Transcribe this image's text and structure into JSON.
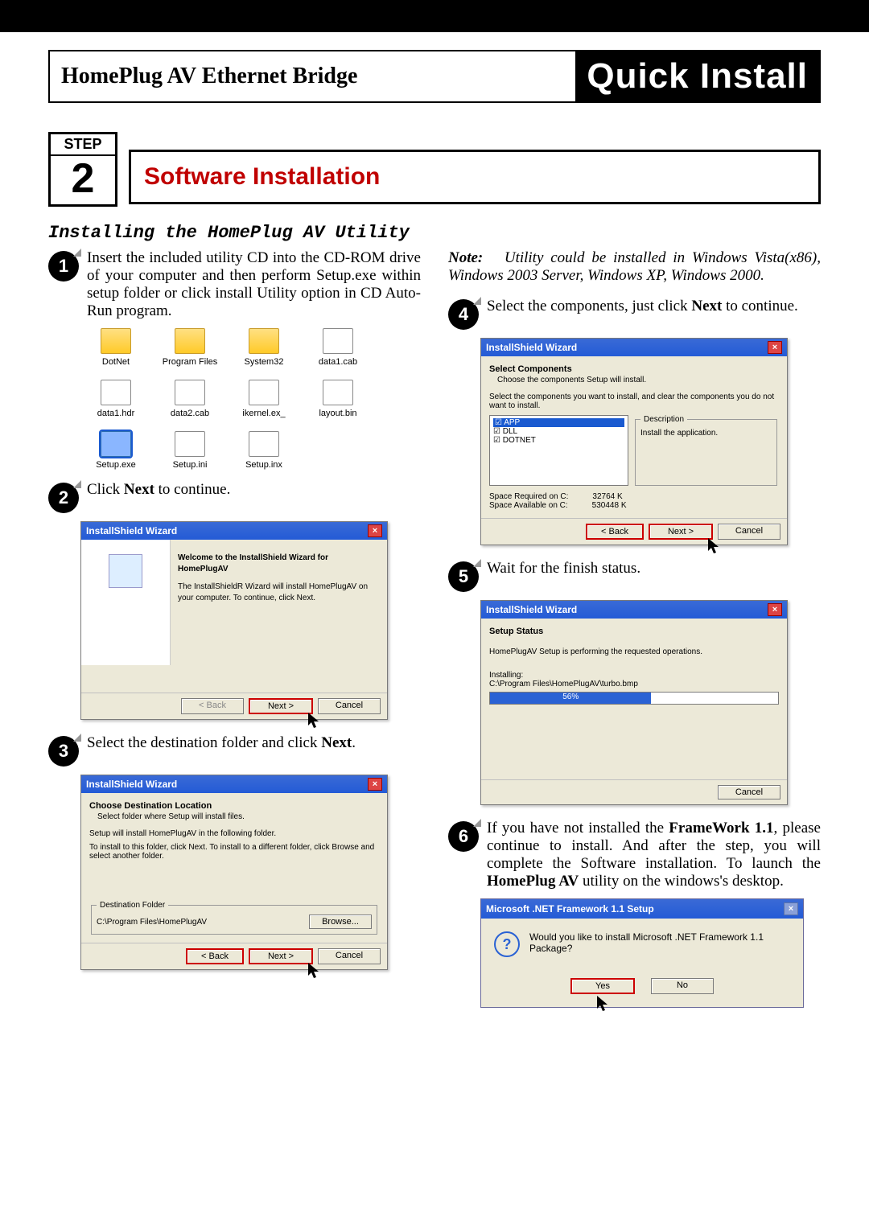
{
  "header": {
    "left": "HomePlug AV Ethernet Bridge",
    "right": "Quick Install"
  },
  "step": {
    "label": "STEP",
    "num": "2",
    "title": "Software Installation"
  },
  "subhead": "Installing the HomePlug AV Utility",
  "note": {
    "label": "Note:",
    "text": "Utility could be installed in Windows Vista(x86), Windows 2003 Server, Windows XP, Windows 2000."
  },
  "bullets": {
    "b1": "Insert the included utility CD into the CD-ROM drive of your computer and then perform Setup.exe within setup folder or click install Utility option in CD Auto-Run program.",
    "b2_pre": "Click ",
    "b2_next": "Next",
    "b2_post": " to continue.",
    "b3_pre": "Select the destination folder and click ",
    "b3_next": "Next",
    "b3_post": ".",
    "b4_pre": "Select the components, just click ",
    "b4_next": "Next",
    "b4_post": " to continue.",
    "b5": "Wait for the finish status.",
    "b6_a": "If you have not installed the ",
    "b6_b": "FrameWork 1.1",
    "b6_c": ", please continue to install. And after the step, you will complete the Software installation. To launch the ",
    "b6_d": "HomePlug AV",
    "b6_e": " utility on the windows's desktop."
  },
  "folders": [
    "DotNet",
    "Program Files",
    "System32",
    "data1.cab",
    "data1.hdr",
    "data2.cab",
    "ikernel.ex_",
    "layout.bin",
    "Setup.exe",
    "Setup.ini",
    "Setup.inx"
  ],
  "win_common": {
    "title": "InstallShield Wizard",
    "back": "< Back",
    "next": "Next >",
    "cancel": "Cancel",
    "browse": "Browse..."
  },
  "win2": {
    "h": "Welcome to the InstallShield Wizard for HomePlugAV",
    "p": "The InstallShieldR Wizard will install HomePlugAV on your computer.  To continue, click Next."
  },
  "win3": {
    "h": "Choose Destination Location",
    "sub": "Select folder where Setup will install files.",
    "l1": "Setup will install HomePlugAV in the following folder.",
    "l2": "To install to this folder, click Next. To install to a different folder, click Browse and select another folder.",
    "dfLegend": "Destination Folder",
    "path": "C:\\Program Files\\HomePlugAV"
  },
  "win4": {
    "h": "Select Components",
    "sub": "Choose the components Setup will install.",
    "l1": "Select the components you want to install, and clear the components you do not want to install.",
    "items": [
      "APP",
      "DLL",
      "DOTNET"
    ],
    "descLegend": "Description",
    "desc": "Install the application.",
    "sr": "Space Required on  C:",
    "srv": "32764 K",
    "sa": "Space Available on  C:",
    "sav": "530448 K"
  },
  "win5": {
    "h": "Setup Status",
    "l1": "HomePlugAV Setup is performing the requested operations.",
    "l2": "Installing:",
    "path": "C:\\Program Files\\HomePlugAV\\turbo.bmp",
    "pct": "56%"
  },
  "dotnet": {
    "title": "Microsoft .NET Framework 1.1 Setup",
    "q": "Would you like to install Microsoft .NET Framework 1.1 Package?",
    "yes": "Yes",
    "no": "No"
  }
}
